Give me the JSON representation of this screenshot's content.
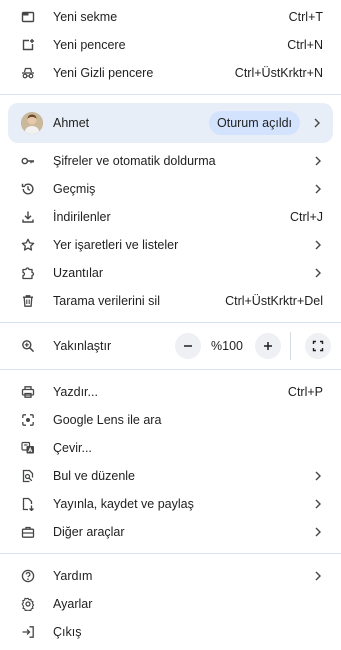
{
  "menu": {
    "new_tab": {
      "label": "Yeni sekme",
      "shortcut": "Ctrl+T",
      "icon": "new-tab-icon"
    },
    "new_window": {
      "label": "Yeni pencere",
      "shortcut": "Ctrl+N",
      "icon": "new-window-icon"
    },
    "incognito": {
      "label": "Yeni Gizli pencere",
      "shortcut": "Ctrl+ÜstKrktr+N",
      "icon": "incognito-icon"
    },
    "profile": {
      "name": "Ahmet",
      "status": "Oturum açıldı"
    },
    "passwords": {
      "label": "Şifreler ve otomatik doldurma",
      "icon": "key-icon"
    },
    "history": {
      "label": "Geçmiş",
      "icon": "history-icon"
    },
    "downloads": {
      "label": "İndirilenler",
      "shortcut": "Ctrl+J",
      "icon": "download-icon"
    },
    "bookmarks": {
      "label": "Yer işaretleri ve listeler",
      "icon": "star-icon"
    },
    "extensions": {
      "label": "Uzantılar",
      "icon": "puzzle-icon"
    },
    "clear_data": {
      "label": "Tarama verilerini sil",
      "shortcut": "Ctrl+ÜstKrktr+Del",
      "icon": "trash-icon"
    },
    "zoom": {
      "label": "Yakınlaştır",
      "value": "%100",
      "minus": "−",
      "plus": "+"
    },
    "print": {
      "label": "Yazdır...",
      "shortcut": "Ctrl+P",
      "icon": "printer-icon"
    },
    "lens": {
      "label": "Google Lens ile ara",
      "icon": "lens-icon"
    },
    "translate": {
      "label": "Çevir...",
      "icon": "translate-icon"
    },
    "find_edit": {
      "label": "Bul ve düzenle",
      "icon": "find-icon"
    },
    "cast_save_share": {
      "label": "Yayınla, kaydet ve paylaş",
      "icon": "share-file-icon"
    },
    "more_tools": {
      "label": "Diğer araçlar",
      "icon": "toolbox-icon"
    },
    "help": {
      "label": "Yardım",
      "icon": "help-icon"
    },
    "settings": {
      "label": "Ayarlar",
      "icon": "gear-icon"
    },
    "exit": {
      "label": "Çıkış",
      "icon": "exit-icon"
    }
  },
  "colors": {
    "profile_bg": "#e8eef8",
    "badge_bg": "#d3e3fd",
    "separator": "#d6e2f0",
    "icon": "#444746"
  }
}
